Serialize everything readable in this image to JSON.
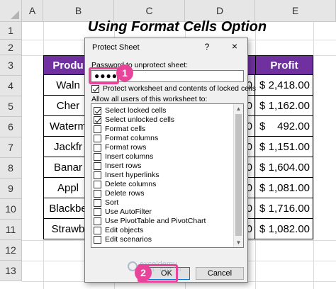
{
  "columns": [
    "A",
    "B",
    "C",
    "D",
    "E"
  ],
  "rows": [
    "1",
    "2",
    "3",
    "4",
    "5",
    "6",
    "7",
    "8",
    "9",
    "10",
    "11",
    "12",
    "13"
  ],
  "sheet": {
    "title": "Using Format Cells Option",
    "header_product": "Produ",
    "header_profit": "Profit",
    "products": [
      "Waln",
      "Cher",
      "Waterm",
      "Jackfr",
      "Banar",
      "Appl",
      "Blackbe",
      "Strawb"
    ],
    "mid_values": [
      "0",
      "0",
      "0",
      "0",
      "0",
      "0",
      "0",
      "0"
    ],
    "currency_symbol": "$",
    "profits": [
      "2,418.00",
      "1,162.00",
      "492.00",
      "1,151.00",
      "1,604.00",
      "1,081.00",
      "1,716.00",
      "1,082.00"
    ],
    "accent_color": "#7030a0"
  },
  "dialog": {
    "title": "Protect Sheet",
    "help_glyph": "?",
    "close_glyph": "×",
    "password_label": "Password to unprotect sheet:",
    "password_value": "●●●●",
    "protect_label": "Protect worksheet and contents of locked cells",
    "protect_checked": true,
    "allow_label": "Allow all users of this worksheet to:",
    "permissions": [
      {
        "label": "Select locked cells",
        "checked": true
      },
      {
        "label": "Select unlocked cells",
        "checked": true
      },
      {
        "label": "Format cells",
        "checked": false
      },
      {
        "label": "Format columns",
        "checked": false
      },
      {
        "label": "Format rows",
        "checked": false
      },
      {
        "label": "Insert columns",
        "checked": false
      },
      {
        "label": "Insert rows",
        "checked": false
      },
      {
        "label": "Insert hyperlinks",
        "checked": false
      },
      {
        "label": "Delete columns",
        "checked": false
      },
      {
        "label": "Delete rows",
        "checked": false
      },
      {
        "label": "Sort",
        "checked": false
      },
      {
        "label": "Use AutoFilter",
        "checked": false
      },
      {
        "label": "Use PivotTable and PivotChart",
        "checked": false
      },
      {
        "label": "Edit objects",
        "checked": false
      },
      {
        "label": "Edit scenarios",
        "checked": false
      }
    ],
    "ok_label": "OK",
    "cancel_label": "Cancel"
  },
  "callouts": {
    "step1": "1",
    "step2": "2",
    "highlight_color": "#e8459a"
  },
  "watermark": {
    "brand": "exceldemy",
    "tagline": "EXCEL · DATA · BI"
  }
}
